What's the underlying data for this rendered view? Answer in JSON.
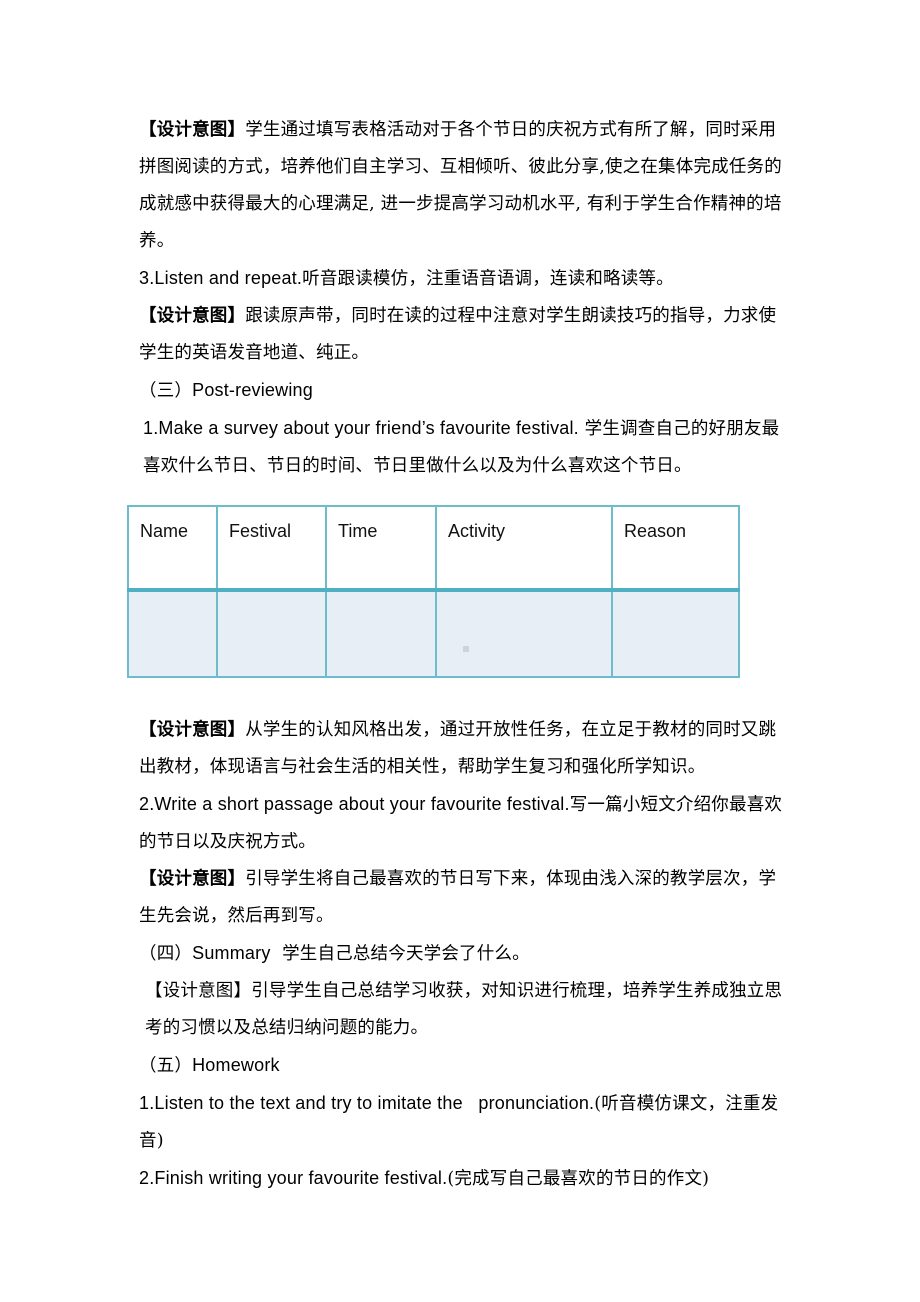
{
  "sections": {
    "intent_1": {
      "label": "【设计意图】",
      "text": "学生通过填写表格活动对于各个节日的庆祝方式有所了解，同时采用拼图阅读的方式，培养他们自主学习、互相倾听、彼此分享,使之在集体完成任务的成就感中获得最大的心理满足, 进一步提高学习动机水平, 有利于学生合作精神的培养。"
    },
    "step_3": {
      "en": "3.Listen and repeat.",
      "zh": "听音跟读模仿，注重语音语调，连读和略读等。"
    },
    "intent_2": {
      "label": "【设计意图】",
      "text": "跟读原声带，同时在读的过程中注意对学生朗读技巧的指导，力求使学生的英语发音地道、纯正。"
    },
    "post_reviewing": {
      "prefix": "（三）",
      "title": "Post-reviewing"
    },
    "survey": {
      "en": "1.Make a survey about your friend’s favourite festival.",
      "zh": "学生调查自己的好朋友最喜欢什么节日、节日的时间、节日里做什么以及为什么喜欢这个节日。"
    },
    "table": {
      "headers": [
        "Name",
        "Festival",
        "Time",
        "Activity",
        "Reason"
      ],
      "rows": [
        [
          "",
          "",
          "",
          "",
          ""
        ]
      ]
    },
    "intent_3": {
      "label": "【设计意图】",
      "text": "从学生的认知风格出发，通过开放性任务，在立足于教材的同时又跳出教材，体现语言与社会生活的相关性，帮助学生复习和强化所学知识。"
    },
    "writing": {
      "en": "2.Write a short passage about your favourite festival.",
      "zh": "写一篇小短文介绍你最喜欢的节日以及庆祝方式。"
    },
    "intent_4": {
      "label": "【设计意图】",
      "text": "引导学生将自己最喜欢的节日写下来，体现由浅入深的教学层次，学生先会说，然后再到写。"
    },
    "summary": {
      "prefix": "（四）",
      "title": "Summary",
      "zh": "学生自己总结今天学会了什么。"
    },
    "intent_5": {
      "label": "【设计意图】",
      "text": "引导学生自己总结学习收获，对知识进行梳理，培养学生养成独立思考的习惯以及总结归纳问题的能力。"
    },
    "homework": {
      "prefix": "（五）",
      "title": "Homework",
      "item_1_en": "1.Listen to the text and try to imitate the   pronunciation.",
      "item_1_zh": "(听音模仿课文，注重发音)",
      "item_2_en": "2.Finish writing your favourite festival.",
      "item_2_zh": "(完成写自己最喜欢的节日的作文)"
    }
  },
  "colors": {
    "table_border": "#6cbccc",
    "table_header_divider": "#4fb0c4",
    "table_body_fill": "#e8eef6"
  }
}
